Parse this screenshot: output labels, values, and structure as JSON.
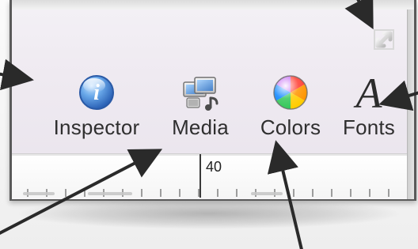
{
  "toolbar": {
    "items": [
      {
        "label": "Inspector",
        "icon": "info-icon"
      },
      {
        "label": "Media",
        "icon": "media-icon"
      },
      {
        "label": "Colors",
        "icon": "color-wheel-icon"
      },
      {
        "label": "Fonts",
        "icon": "fonts-icon"
      }
    ]
  },
  "ruler": {
    "label": "40"
  },
  "colors": {
    "frame": "#5a5a5a",
    "toolbar_bg": "#efeaf1",
    "label_text": "#2f2f2f",
    "arrow": "#2a2a2a"
  },
  "annotations": {
    "callout_arrow_count": 6
  }
}
